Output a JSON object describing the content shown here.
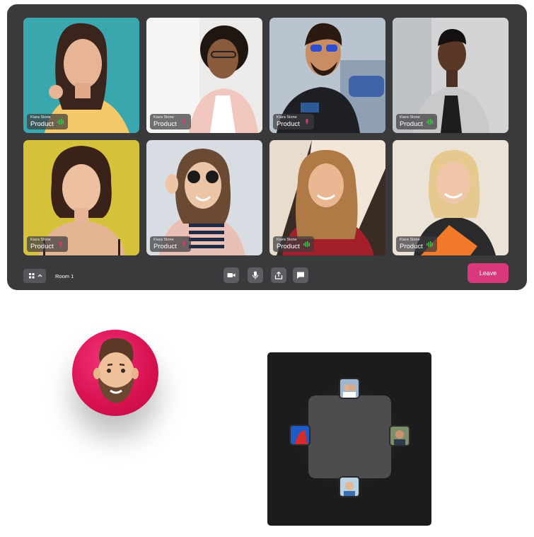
{
  "call": {
    "participants": [
      {
        "name": "Kiara Stone",
        "role": "Product",
        "audio": "speaking"
      },
      {
        "name": "Kiara Stone",
        "role": "Product",
        "audio": "muted"
      },
      {
        "name": "Kiara Stone",
        "role": "Product",
        "audio": "muted"
      },
      {
        "name": "Kiara Stone",
        "role": "Product",
        "audio": "speaking"
      },
      {
        "name": "Kiara Stone",
        "role": "Product",
        "audio": "muted"
      },
      {
        "name": "Kiara Stone",
        "role": "Product",
        "audio": "muted"
      },
      {
        "name": "Kiara Stone",
        "role": "Product",
        "audio": "speaking"
      },
      {
        "name": "Kiara Stone",
        "role": "Product",
        "audio": "speaking"
      }
    ]
  },
  "toolbar": {
    "room_label": "Room 1",
    "leave_label": "Leave",
    "controls": [
      "video-icon",
      "microphone-icon",
      "share-icon",
      "chat-icon"
    ]
  },
  "colors": {
    "window_bg": "#3a393b",
    "leave_button": "#d9397a",
    "speaking": "#3cc24a",
    "muted": "#d9397a",
    "avatar_bg": "#e01b5c",
    "mini_panel_bg": "#1c1c1d"
  }
}
